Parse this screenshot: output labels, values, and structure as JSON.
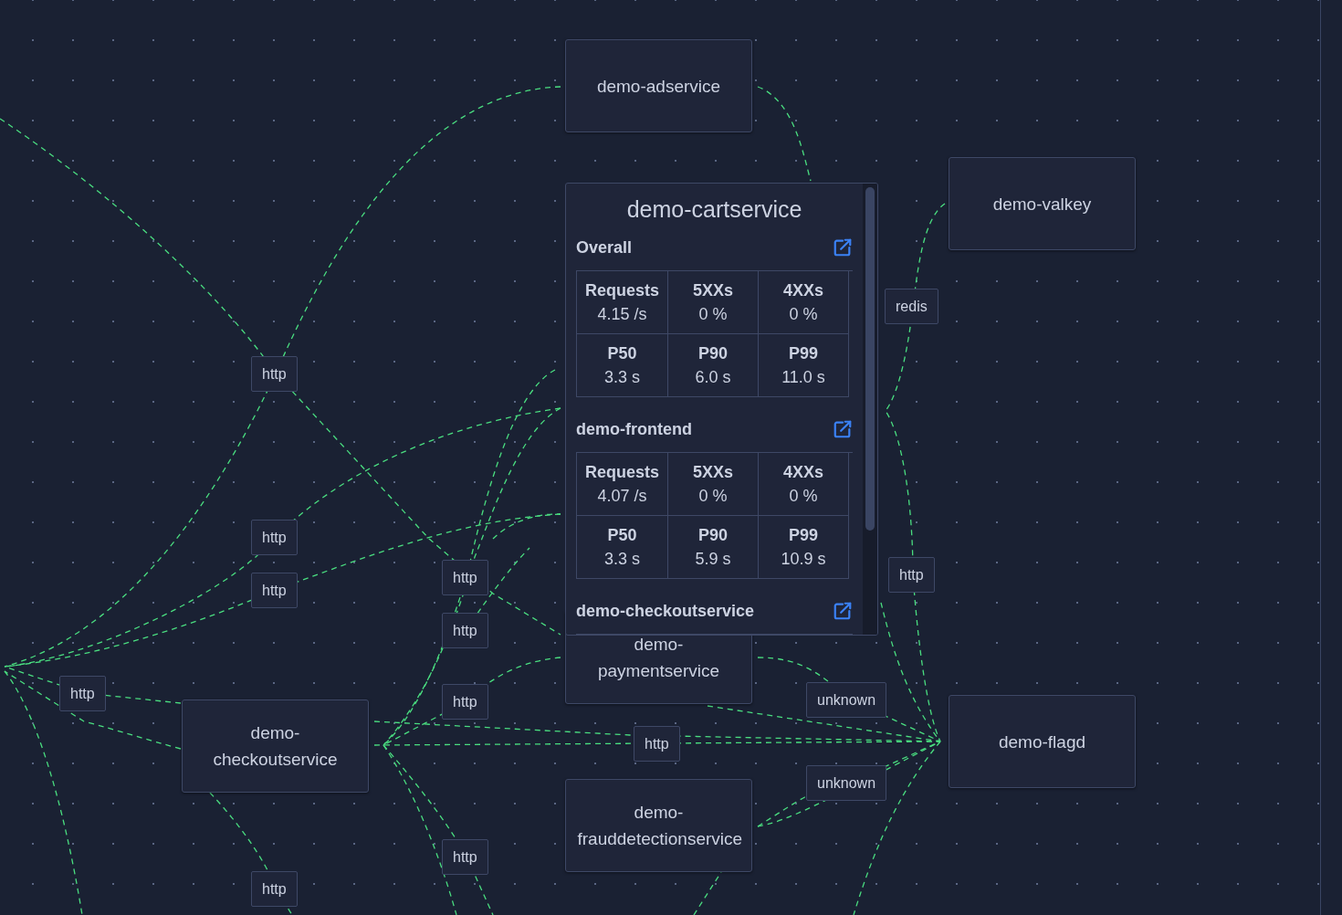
{
  "nodes": [
    {
      "label": "demo-adservice"
    },
    {
      "label": "demo-valkey"
    },
    {
      "label": "demo-paymentservice"
    },
    {
      "label": "demo-checkoutservice"
    },
    {
      "label": "demo-frauddetectionservice"
    },
    {
      "label": "demo-flagd"
    }
  ],
  "edge_labels": [
    {
      "label": "http"
    },
    {
      "label": "redis"
    },
    {
      "label": "http"
    },
    {
      "label": "http"
    },
    {
      "label": "http"
    },
    {
      "label": "http"
    },
    {
      "label": "http"
    },
    {
      "label": "http"
    },
    {
      "label": "http"
    },
    {
      "label": "unknown"
    },
    {
      "label": "http"
    },
    {
      "label": "unknown"
    },
    {
      "label": "http"
    },
    {
      "label": "http"
    }
  ],
  "popup": {
    "title": "demo-cartservice",
    "sections": [
      {
        "title": "Overall",
        "metrics": [
          {
            "name": "Requests",
            "value": "4.15 /s"
          },
          {
            "name": "5XXs",
            "value": "0 %"
          },
          {
            "name": "4XXs",
            "value": "0 %"
          },
          {
            "name": "P50",
            "value": "3.3 s"
          },
          {
            "name": "P90",
            "value": "6.0 s"
          },
          {
            "name": "P99",
            "value": "11.0 s"
          }
        ]
      },
      {
        "title": "demo-frontend",
        "metrics": [
          {
            "name": "Requests",
            "value": "4.07 /s"
          },
          {
            "name": "5XXs",
            "value": "0 %"
          },
          {
            "name": "4XXs",
            "value": "0 %"
          },
          {
            "name": "P50",
            "value": "3.3 s"
          },
          {
            "name": "P90",
            "value": "5.9 s"
          },
          {
            "name": "P99",
            "value": "10.9 s"
          }
        ]
      },
      {
        "title": "demo-checkoutservice"
      }
    ]
  }
}
